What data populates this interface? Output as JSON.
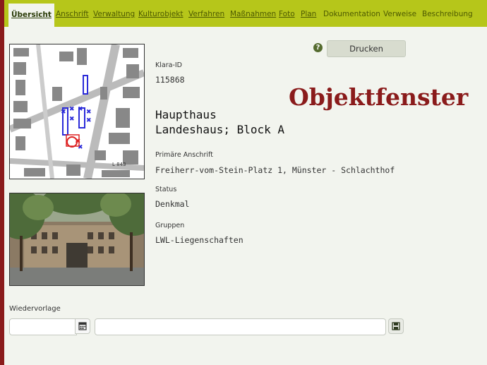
{
  "tabs": [
    {
      "label": "Übersicht",
      "active": true
    },
    {
      "label": "Anschrift"
    },
    {
      "label": "Verwaltung"
    },
    {
      "label": "Kulturobjekt"
    },
    {
      "label": "Verfahren"
    },
    {
      "label": "Maßnahmen"
    },
    {
      "label": "Foto"
    },
    {
      "label": "Plan"
    },
    {
      "label": "Dokumentation"
    },
    {
      "label": "Verweise"
    },
    {
      "label": "Beschreibung"
    }
  ],
  "toolbar": {
    "print_label": "Drucken",
    "help_icon": "question-circle-icon"
  },
  "watermark": "Objektfenster",
  "object": {
    "klara_id_label": "Klara-ID",
    "klara_id": "115868",
    "title_line1": "Haupthaus",
    "title_line2": "Landeshaus; Block A",
    "address_label": "Primäre Anschrift",
    "address": "Freiherr-vom-Stein-Platz 1, Münster - Schlachthof",
    "status_label": "Status",
    "status": "Denkmal",
    "groups_label": "Gruppen",
    "groups": "LWL-Liegenschaften"
  },
  "map": {
    "street_label": "L 843"
  },
  "resubmission": {
    "label": "Wiedervorlage",
    "date_value": "",
    "note_value": "",
    "calendar_icon": "calendar-icon",
    "save_icon": "save-icon"
  },
  "colors": {
    "topbar": "#b6c61a",
    "accent": "#8a1b1b",
    "background": "#f2f4ee"
  }
}
